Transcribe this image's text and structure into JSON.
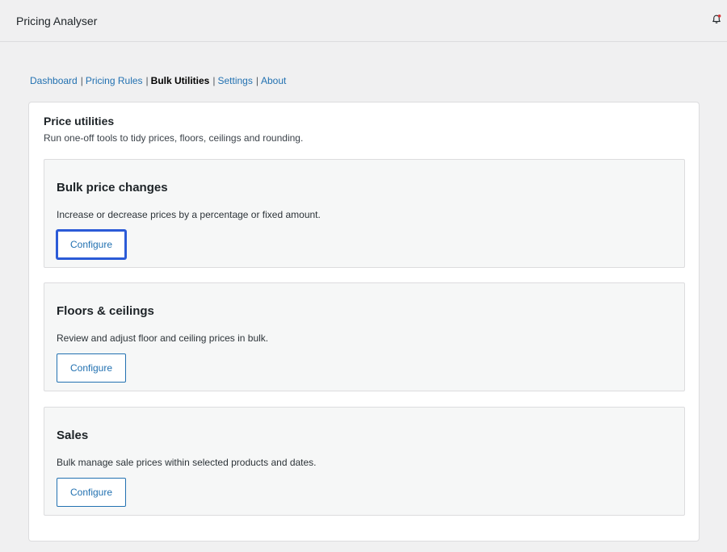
{
  "app": {
    "title": "Pricing Analyser"
  },
  "topbar": {
    "notification_icon": "bell-icon",
    "notification_color": "#d63638"
  },
  "subnav": {
    "items": [
      {
        "label": "Dashboard",
        "current": false
      },
      {
        "label": "Pricing Rules",
        "current": false
      },
      {
        "label": "Bulk Utilities",
        "current": true
      },
      {
        "label": "Settings",
        "current": false
      },
      {
        "label": "About",
        "current": false
      }
    ],
    "separator": "|"
  },
  "panel": {
    "title": "Price utilities",
    "description": "Run one-off tools to tidy prices, floors, ceilings and rounding."
  },
  "cards": [
    {
      "title": "Bulk price changes",
      "description": "Increase or decrease prices by a percentage or fixed amount.",
      "button_label": "Configure",
      "focused": true
    },
    {
      "title": "Floors & ceilings",
      "description": "Review and adjust floor and ceiling prices in bulk.",
      "button_label": "Configure",
      "focused": false
    },
    {
      "title": "Sales",
      "description": "Bulk manage sale prices within selected products and dates.",
      "button_label": "Configure",
      "focused": false
    }
  ],
  "colors": {
    "link": "#2271b1",
    "accent": "#2b5bd7",
    "background": "#f0f0f1"
  }
}
